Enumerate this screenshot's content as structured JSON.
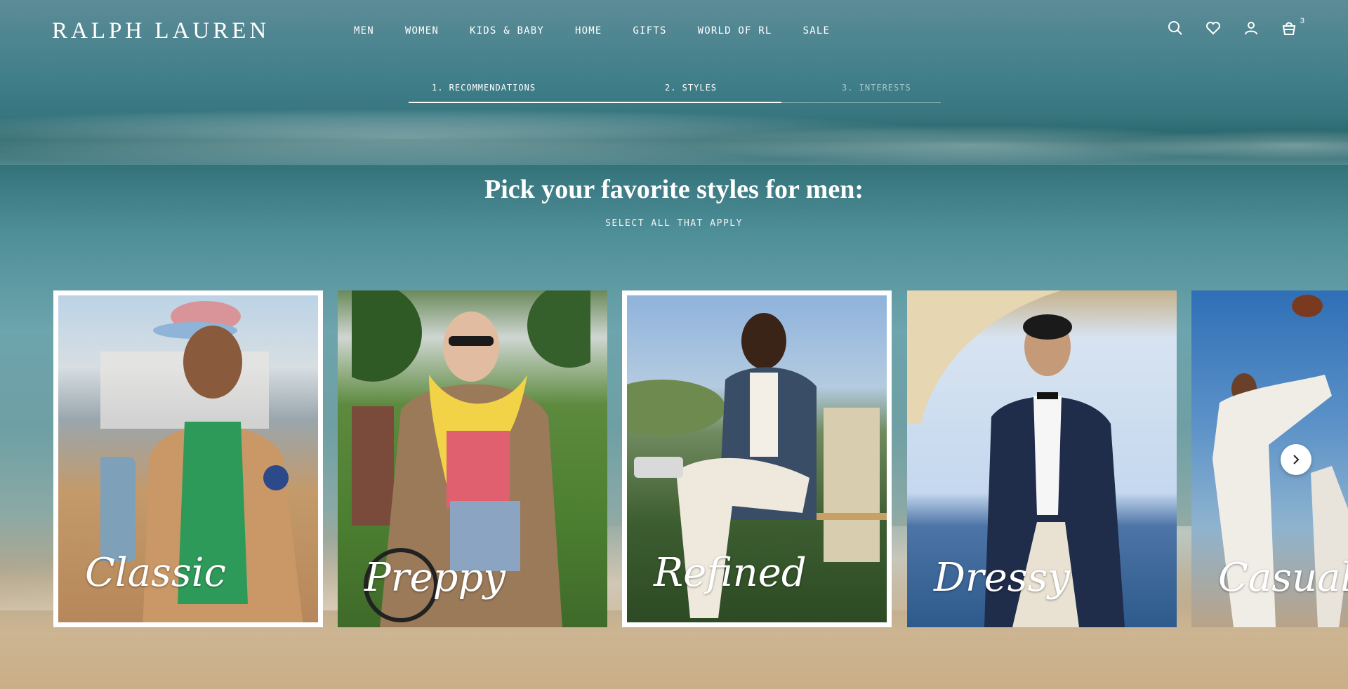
{
  "brand": {
    "logo_text": "RALPH LAUREN"
  },
  "nav": {
    "items": [
      {
        "label": "MEN"
      },
      {
        "label": "WOMEN"
      },
      {
        "label": "KIDS & BABY"
      },
      {
        "label": "HOME"
      },
      {
        "label": "GIFTS"
      },
      {
        "label": "WORLD OF RL"
      },
      {
        "label": "SALE"
      }
    ]
  },
  "header_icons": {
    "search": "search-icon",
    "wishlist": "heart-icon",
    "account": "user-icon",
    "bag": "shopping-bag-icon",
    "bag_count": "3"
  },
  "steps": {
    "items": [
      {
        "label": "1. RECOMMENDATIONS",
        "state": "complete"
      },
      {
        "label": "2. STYLES",
        "state": "active"
      },
      {
        "label": "3. INTERESTS",
        "state": "upcoming"
      }
    ],
    "progress_fraction": 0.7
  },
  "heading": {
    "title": "Pick your favorite styles for men:",
    "subtitle": "SELECT ALL THAT APPLY"
  },
  "styles": [
    {
      "label": "Classic",
      "selected": true
    },
    {
      "label": "Preppy",
      "selected": false
    },
    {
      "label": "Refined",
      "selected": true
    },
    {
      "label": "Dressy",
      "selected": false
    },
    {
      "label": "Casual",
      "selected": false
    }
  ],
  "carousel": {
    "next_icon": "chevron-right-icon"
  },
  "colors": {
    "text": "#ffffff",
    "accent_border": "#ffffff"
  }
}
